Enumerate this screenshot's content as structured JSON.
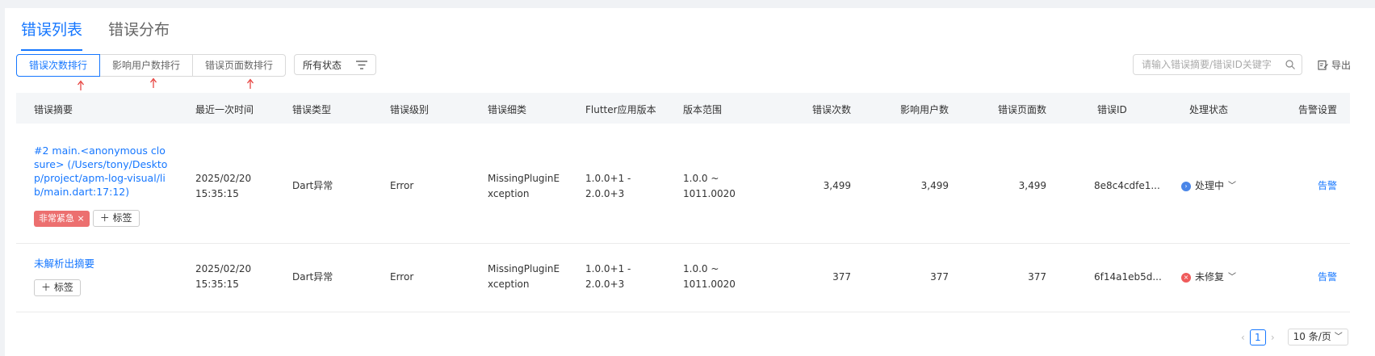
{
  "tabs": [
    {
      "label": "错误列表",
      "active": true
    },
    {
      "label": "错误分布",
      "active": false
    }
  ],
  "sort_buttons": [
    {
      "label": "错误次数排行",
      "active": true
    },
    {
      "label": "影响用户数排行",
      "active": false
    },
    {
      "label": "错误页面数排行",
      "active": false
    }
  ],
  "status_filter": {
    "label": "所有状态",
    "icon": "filter-icon"
  },
  "search": {
    "placeholder": "请输入错误摘要/错误ID关键字",
    "value": "",
    "icon": "search-icon"
  },
  "export": {
    "label": "导出",
    "icon": "export-icon"
  },
  "table": {
    "columns": [
      "错误摘要",
      "最近一次时间",
      "错误类型",
      "错误级别",
      "错误细类",
      "Flutter应用版本",
      "版本范围",
      "错误次数",
      "影响用户数",
      "错误页面数",
      "错误ID",
      "处理状态",
      "告警设置"
    ],
    "rows": [
      {
        "summary": "#2 main.<anonymous closure> (/Users/tony/Desktop/project/apm-log-visual/lib/main.dart:17:12)",
        "tags": [
          {
            "label": "非常紧急",
            "color": "#ec6f6f"
          }
        ],
        "add_tag": "标签",
        "time": "2025/02/20 15:35:15",
        "type": "Dart异常",
        "level": "Error",
        "subtype": "MissingPluginException",
        "flutter_version": "1.0.0+1 - 2.0.0+3",
        "version_range": "1.0.0 ~ 1011.0020",
        "error_count": "3,499",
        "user_count": "3,499",
        "page_count": "3,499",
        "error_id": "8e8c4cdfe1...",
        "status": "处理中",
        "status_color": "#4a86e8",
        "alarm": "告警"
      },
      {
        "summary": "未解析出摘要",
        "tags": [],
        "add_tag": "标签",
        "time": "2025/02/20 15:35:15",
        "type": "Dart异常",
        "level": "Error",
        "subtype": "MissingPluginException",
        "flutter_version": "1.0.0+1 - 2.0.0+3",
        "version_range": "1.0.0 ~ 1011.0020",
        "error_count": "377",
        "user_count": "377",
        "page_count": "377",
        "error_id": "6f14a1eb5d...",
        "status": "未修复",
        "status_color": "#ef5b5b",
        "alarm": "告警"
      }
    ]
  },
  "pagination": {
    "current": "1",
    "page_size": "10 条/页"
  },
  "colors": {
    "accent": "#1677ff",
    "annotation_arrow": "#e53935"
  }
}
